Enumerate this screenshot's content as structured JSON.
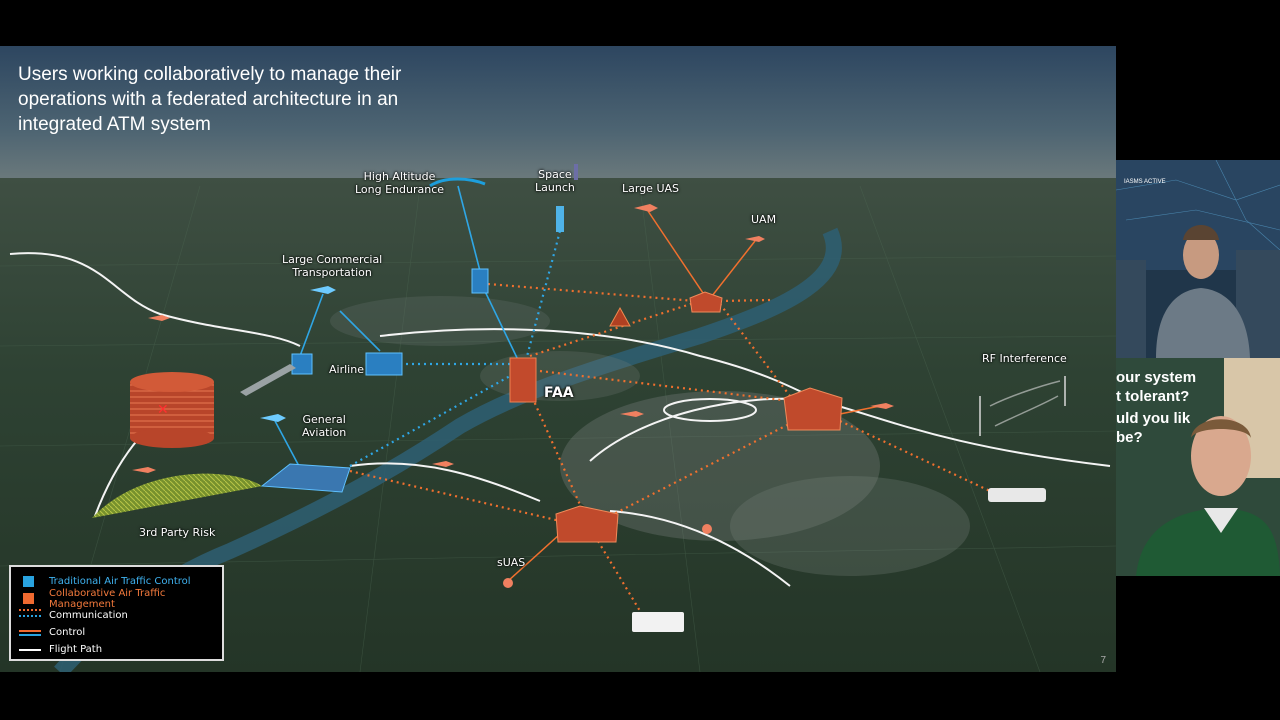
{
  "slide": {
    "title": "Users working collaboratively to manage their operations with a federated architecture in an integrated ATM system",
    "page_number": "7",
    "labels": {
      "high_altitude_1": "High Altitude",
      "high_altitude_2": "Long Endurance",
      "space_1": "Space",
      "space_2": "Launch",
      "large_uas": "Large UAS",
      "uam": "UAM",
      "large_commercial_1": "Large Commercial",
      "large_commercial_2": "Transportation",
      "airline": "Airline",
      "faa": "FAA",
      "general_aviation_1": "General",
      "general_aviation_2": "Aviation",
      "third_party_risk": "3rd Party Risk",
      "suas": "sUAS",
      "rf_interference": "RF Interference"
    },
    "legend": {
      "traditional_atc": "Traditional Air Traffic Control",
      "collaborative_atm": "Collaborative Air Traffic Management",
      "communication": "Communication",
      "control": "Control",
      "flight_path": "Flight Path"
    },
    "colors": {
      "traditional": "#29a3e0",
      "collaborative": "#f06a30",
      "flight_path": "#ffffff"
    }
  },
  "webcams": {
    "participant_1_background": [
      "IASMS   ACTIVE"
    ],
    "participant_2_background": [
      "our system",
      "t tolerant?",
      "uld you lik",
      "be?"
    ]
  }
}
